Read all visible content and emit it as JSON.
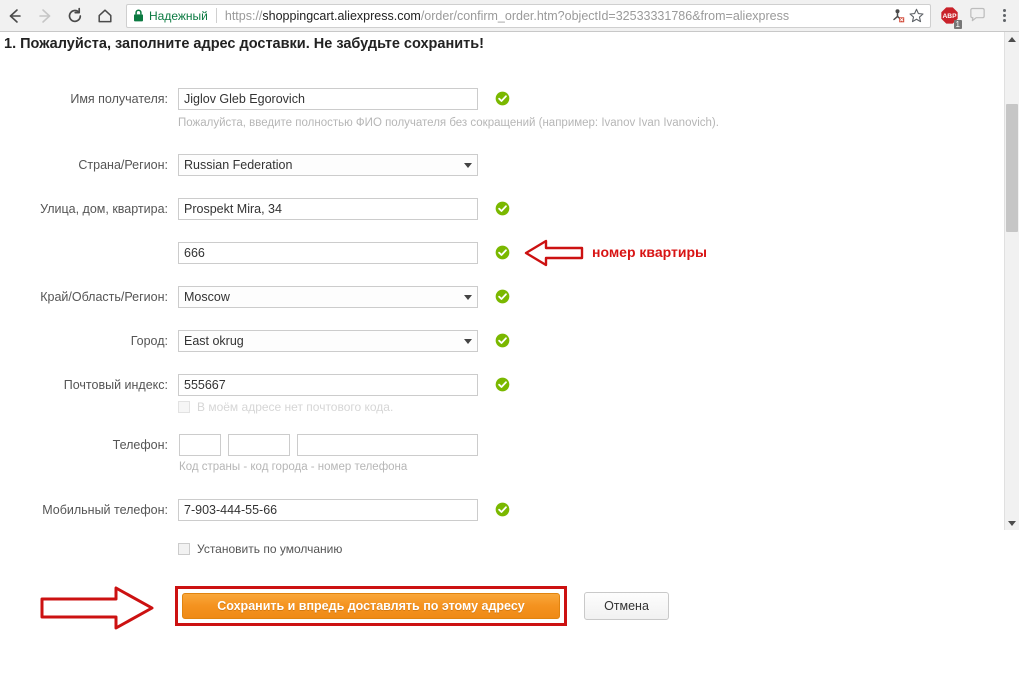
{
  "browser": {
    "back_icon": "back-arrow-icon",
    "forward_icon": "forward-arrow-icon",
    "reload_icon": "reload-icon",
    "home_icon": "home-icon",
    "security_label": "Надежный",
    "lock_icon": "lock-icon",
    "url_scheme": "https://",
    "url_host": "shoppingcart.aliexpress.com",
    "url_path": "/order/confirm_order.htm?objectId=32533331786&from=aliexpress",
    "url_full": "https://shoppingcart.aliexpress.com/order/confirm_order.htm?objectId=32533331786&from=aliexpress",
    "save_page_icon": "save-page-icon",
    "bookmark_icon": "star-bookmark-icon",
    "adblock_icon": "abp-adblock-icon",
    "adblock_badge": "1",
    "speech_icon": "speech-bubble-icon",
    "menu_icon": "three-dots-menu-icon",
    "secure_color": "#0b7a41"
  },
  "page": {
    "heading": "1. Пожалуйста, заполните адрес доставки. Не забудьте сохранить!"
  },
  "form": {
    "fields": [
      {
        "id": "recipient-name",
        "label": "Имя получателя:",
        "value": "Jiglov Gleb Egorovich",
        "placeholder": "",
        "valid": true,
        "hint": "Пожалуйста, введите полностью ФИО получателя без сокращений (например: Ivanov Ivan Ivanovich)."
      },
      {
        "id": "country-region",
        "label": "Страна/Регион:",
        "value": "Russian Federation",
        "type": "select",
        "valid": false
      },
      {
        "id": "street-address",
        "label": "Улица, дом, квартира:",
        "value": "Prospekt Mira, 34",
        "valid": true
      },
      {
        "id": "apartment-number",
        "label": "",
        "value": "666",
        "valid": true
      },
      {
        "id": "province-region",
        "label": "Край/Область/Регион:",
        "value": "Moscow",
        "type": "select",
        "valid": true
      },
      {
        "id": "city",
        "label": "Город:",
        "value": "East okrug",
        "type": "select",
        "valid": true
      },
      {
        "id": "postal-code",
        "label": "Почтовый индекс:",
        "value": "555667",
        "valid": true
      },
      {
        "id": "mobile-phone",
        "label": "Мобильный телефон:",
        "value": "7-903-444-55-66",
        "valid": true
      }
    ],
    "no_postcode_checkbox": {
      "label": "В моём адресе нет почтового кода.",
      "checked": false,
      "disabled": true
    },
    "phone": {
      "label": "Телефон:",
      "country_code": "",
      "area_code": "",
      "number": "",
      "hint": "Код страны - код города - номер телефона"
    },
    "default_checkbox": {
      "label": "Установить по умолчанию",
      "checked": false
    },
    "save_button": "Сохранить и впредь доставлять по этому адресу",
    "cancel_button": "Отмена"
  },
  "annotations": {
    "apartment_note": "номер квартиры",
    "arrow_left_icon": "red-arrow-left-icon",
    "arrow_right_icon": "red-arrow-right-icon",
    "highlight_box_icon": "red-highlight-rectangle",
    "color": "#d81414"
  }
}
